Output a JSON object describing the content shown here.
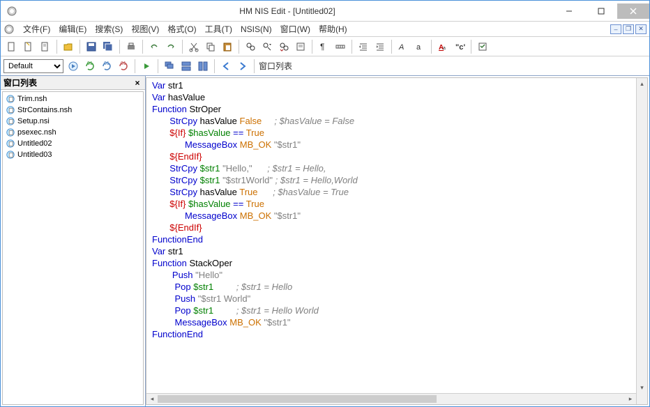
{
  "title": "HM NIS Edit - [Untitled02]",
  "menus": [
    "文件(F)",
    "编辑(E)",
    "搜索(S)",
    "视图(V)",
    "格式(O)",
    "工具(T)",
    "NSIS(N)",
    "窗口(W)",
    "帮助(H)"
  ],
  "combo_value": "Default",
  "sidebar_title": "窗口列表",
  "toolbar2_label": "窗口列表",
  "files": [
    "Trim.nsh",
    "StrContains.nsh",
    "Setup.nsi",
    "psexec.nsh",
    "Untitled02",
    "Untitled03"
  ],
  "code": [
    [
      {
        "t": "Var ",
        "c": "kw-blue"
      },
      {
        "t": "str1"
      }
    ],
    [
      {
        "t": "Var ",
        "c": "kw-blue"
      },
      {
        "t": "hasValue"
      }
    ],
    [
      {
        "t": "Function ",
        "c": "kw-blue"
      },
      {
        "t": "StrOper"
      }
    ],
    [
      {
        "t": "       "
      },
      {
        "t": "StrCpy ",
        "c": "kw-blue"
      },
      {
        "t": "hasValue "
      },
      {
        "t": "False",
        "c": "kw-orange"
      },
      {
        "t": "     "
      },
      {
        "t": "; $hasValue = False",
        "c": "kw-comment"
      }
    ],
    [
      {
        "t": "       "
      },
      {
        "t": "${If}",
        "c": "kw-red"
      },
      {
        "t": " $hasValue ",
        "c": "kw-green"
      },
      {
        "t": "== ",
        "c": "kw-blue"
      },
      {
        "t": "True",
        "c": "kw-orange"
      }
    ],
    [
      {
        "t": "             "
      },
      {
        "t": "MessageBox ",
        "c": "kw-blue"
      },
      {
        "t": "MB_OK ",
        "c": "kw-orange"
      },
      {
        "t": "\"$str1\"",
        "c": "kw-str"
      }
    ],
    [
      {
        "t": "       "
      },
      {
        "t": "${EndIf}",
        "c": "kw-red"
      }
    ],
    [
      {
        "t": ""
      }
    ],
    [
      {
        "t": "       "
      },
      {
        "t": "StrCpy ",
        "c": "kw-blue"
      },
      {
        "t": "$str1 ",
        "c": "kw-green"
      },
      {
        "t": "\"Hello,\"",
        "c": "kw-str"
      },
      {
        "t": "      "
      },
      {
        "t": "; $str1 = Hello,",
        "c": "kw-comment"
      }
    ],
    [
      {
        "t": "       "
      },
      {
        "t": "StrCpy ",
        "c": "kw-blue"
      },
      {
        "t": "$str1 ",
        "c": "kw-green"
      },
      {
        "t": "\"$str1World\"",
        "c": "kw-str"
      },
      {
        "t": " "
      },
      {
        "t": "; $str1 = Hello,World",
        "c": "kw-comment"
      }
    ],
    [
      {
        "t": "       "
      },
      {
        "t": "StrCpy ",
        "c": "kw-blue"
      },
      {
        "t": "hasValue "
      },
      {
        "t": "True",
        "c": "kw-orange"
      },
      {
        "t": "      "
      },
      {
        "t": "; $hasValue = True",
        "c": "kw-comment"
      }
    ],
    [
      {
        "t": ""
      }
    ],
    [
      {
        "t": "       "
      },
      {
        "t": "${If}",
        "c": "kw-red"
      },
      {
        "t": " $hasValue ",
        "c": "kw-green"
      },
      {
        "t": "== ",
        "c": "kw-blue"
      },
      {
        "t": "True",
        "c": "kw-orange"
      }
    ],
    [
      {
        "t": "             "
      },
      {
        "t": "MessageBox ",
        "c": "kw-blue"
      },
      {
        "t": "MB_OK ",
        "c": "kw-orange"
      },
      {
        "t": "\"$str1\"",
        "c": "kw-str"
      }
    ],
    [
      {
        "t": "       "
      },
      {
        "t": "${EndIf}",
        "c": "kw-red"
      }
    ],
    [
      {
        "t": "FunctionEnd",
        "c": "kw-blue"
      }
    ],
    [
      {
        "t": ""
      }
    ],
    [
      {
        "t": "Var ",
        "c": "kw-blue"
      },
      {
        "t": "str1"
      }
    ],
    [
      {
        "t": "Function ",
        "c": "kw-blue"
      },
      {
        "t": "StackOper"
      }
    ],
    [
      {
        "t": "        "
      },
      {
        "t": "Push ",
        "c": "kw-blue"
      },
      {
        "t": "\"Hello\"",
        "c": "kw-str"
      }
    ],
    [
      {
        "t": "         "
      },
      {
        "t": "Pop ",
        "c": "kw-blue"
      },
      {
        "t": "$str1",
        "c": "kw-green"
      },
      {
        "t": "         "
      },
      {
        "t": "; $str1 = Hello",
        "c": "kw-comment"
      }
    ],
    [
      {
        "t": "         "
      },
      {
        "t": "Push ",
        "c": "kw-blue"
      },
      {
        "t": "\"$str1 World\"",
        "c": "kw-str"
      }
    ],
    [
      {
        "t": "         "
      },
      {
        "t": "Pop ",
        "c": "kw-blue"
      },
      {
        "t": "$str1",
        "c": "kw-green"
      },
      {
        "t": "         "
      },
      {
        "t": "; $str1 = Hello World",
        "c": "kw-comment"
      }
    ],
    [
      {
        "t": "         "
      },
      {
        "t": "MessageBox ",
        "c": "kw-blue"
      },
      {
        "t": "MB_OK ",
        "c": "kw-orange"
      },
      {
        "t": "\"$str1\"",
        "c": "kw-str"
      }
    ],
    [
      {
        "t": "FunctionEnd",
        "c": "kw-blue"
      }
    ]
  ]
}
